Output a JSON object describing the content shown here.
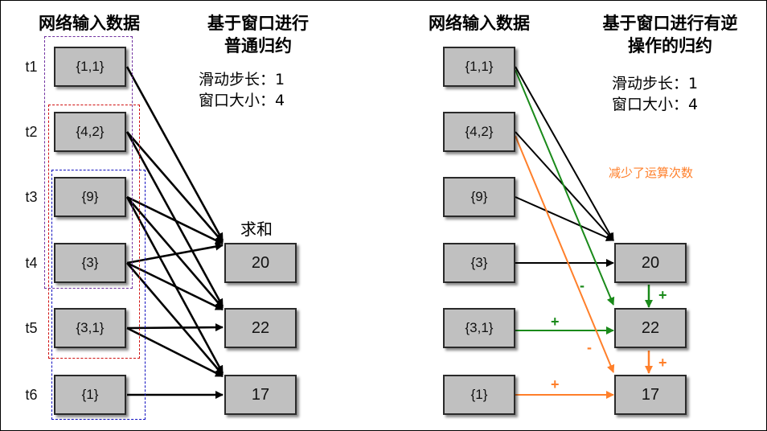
{
  "colors": {
    "purple": "#7030a0",
    "red": "#d01010",
    "blue": "#1010c0",
    "green": "#1a8a1a",
    "orange": "#ff7f2a",
    "box_fill": "#c0c0c0"
  },
  "left": {
    "input_title": "网络输入数据",
    "window_title_line1": "基于窗口进行",
    "window_title_line2": "普通归约",
    "slide_step": "滑动步长：1",
    "window_size": "窗口大小：4",
    "sum_label": "求和",
    "time_labels": [
      "t1",
      "t2",
      "t3",
      "t4",
      "t5",
      "t6"
    ],
    "inputs": [
      "{1,1}",
      "{4,2}",
      "{9}",
      "{3}",
      "{3,1}",
      "{1}"
    ],
    "outputs": [
      "20",
      "22",
      "17"
    ]
  },
  "right": {
    "input_title": "网络输入数据",
    "window_title_line1": "基于窗口进行有逆",
    "window_title_line2": "操作的归约",
    "slide_step": "滑动步长：1",
    "window_size": "窗口大小：4",
    "note": "减少了运算次数",
    "inputs": [
      "{1,1}",
      "{4,2}",
      "{9}",
      "{3}",
      "{3,1}",
      "{1}"
    ],
    "outputs": [
      "20",
      "22",
      "17"
    ],
    "signs": {
      "green_minus": "-",
      "green_plus_between": "+",
      "green_plus_edge": "+",
      "orange_minus": "-",
      "orange_plus_between": "+",
      "orange_plus_edge": "+"
    }
  }
}
